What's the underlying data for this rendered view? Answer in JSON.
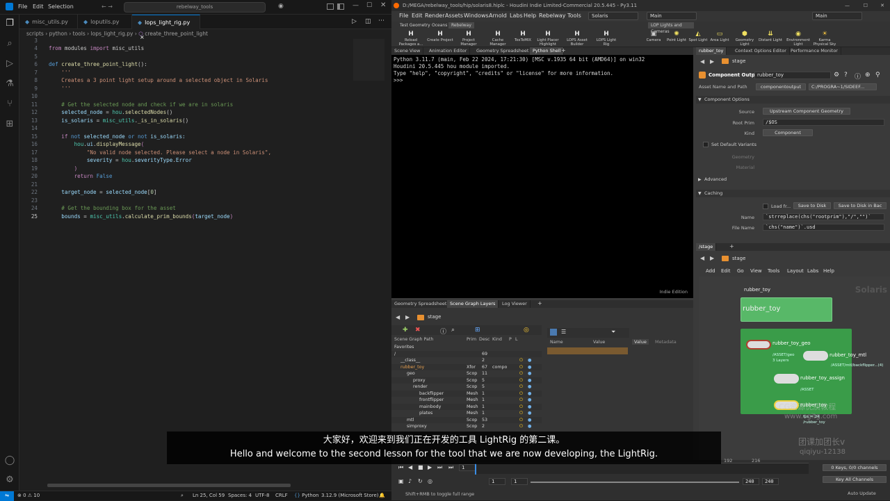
{
  "vscode": {
    "menu": [
      "File",
      "Edit",
      "Selection"
    ],
    "nav_arrows": "← →",
    "search": "rebelway_tools",
    "tabs": [
      {
        "label": "misc_utils.py"
      },
      {
        "label": "loputils.py"
      },
      {
        "label": "lops_light_rig.py"
      }
    ],
    "tab_close": "×",
    "breadcrumb": [
      "scripts",
      "python",
      "tools",
      "lops_light_rig.py",
      "create_three_point_light"
    ],
    "line_numbers": [
      "3",
      "4",
      "5",
      "6",
      "7",
      "8",
      "9",
      "10",
      "11",
      "12",
      "13",
      "14",
      "15",
      "16",
      "17",
      "18",
      "19",
      "20",
      "21",
      "22",
      "23",
      "24",
      "25"
    ],
    "code": {
      "l4a": "from",
      "l4b": " modules ",
      "l4c": "import",
      "l4d": " misc_utils",
      "l6a": "def ",
      "l6b": "create_three_point_light",
      "l6c": "():",
      "l7": "    '''",
      "l8": "    Creates a 3 point light setup around a selected object in Solaris",
      "l9": "    '''",
      "l11": "    # Get the selected node and check if we are in solaris",
      "l12a": "    selected_node",
      "l12b": " = ",
      "l12c": "hou",
      "l12d": ".",
      "l12e": "selectedNodes",
      "l12f": "()",
      "l13a": "    is_solaris",
      "l13b": " = ",
      "l13c": "misc_utils",
      "l13d": ".",
      "l13e": "_is_in_solaris",
      "l13f": "()",
      "l15a": "    if ",
      "l15b": "not ",
      "l15c": "selected_node ",
      "l15d": "or ",
      "l15e": "not ",
      "l15f": "is_solaris:",
      "l16a": "        hou",
      "l16b": ".",
      "l16c": "ui",
      "l16d": ".",
      "l16e": "displayMessage",
      "l16f": "(",
      "l17": "            \"No valid node selected. Please select a node in Solaris\",",
      "l18a": "            severity",
      "l18b": " = ",
      "l18c": "hou",
      "l18d": ".",
      "l18e": "severityType",
      "l18f": ".",
      "l18g": "Error",
      "l19": "        )",
      "l20a": "        return ",
      "l20b": "False",
      "l22a": "    target_node",
      "l22b": " = ",
      "l22c": "selected_node",
      "l22d": "[",
      "l22e": "0",
      "l22f": "]",
      "l24": "    # Get the bounding box for the asset",
      "l25a": "    bounds",
      "l25b": " = ",
      "l25c": "misc_utils",
      "l25d": ".",
      "l25e": "calculate_prim_bounds",
      "l25f": "(",
      "l25g": "target_node",
      "l25h": ")"
    },
    "status": {
      "errors": "⊗ 0 ⚠ 10",
      "ln_col": "Ln 25, Col 59",
      "spaces": "Spaces: 4",
      "encoding": "UTF-8",
      "eol": "CRLF",
      "language": "Python",
      "interpreter": "3.12.9 (Microsoft Store)"
    }
  },
  "houdini": {
    "title": "D:/MEGA/rebelway_tools/hip/solaris8.hiplc - Houdini Indie Limited-Commercial 20.5.445 - Py3.11",
    "menu": [
      "File",
      "Edit",
      "Render",
      "Assets",
      "Windows",
      "Arnold",
      "Labs",
      "Help",
      "Rebelway Tools"
    ],
    "desktop": "Solaris",
    "viewport_dd": "Main",
    "take_dd": "Main",
    "shelf_tabs": [
      "Test Geometry",
      "Oceans",
      "Rebelway"
    ],
    "shelf_tools": [
      "Reload Packages a...",
      "Create Project",
      "Project Manager",
      "Cache Manager",
      "TexToMIX",
      "Light Placer Highlight",
      "LOPS Asset Builder",
      "LOPS Light Rig"
    ],
    "lop_shelf_tab": "LOP Lights and Cameras",
    "lop_tools": [
      "Camera",
      "Point Light",
      "Spot Light",
      "Area Light",
      "Geometry Light",
      "Distant Light",
      "Environment Light",
      "Karma Physical Sky"
    ],
    "pane_tabs_main": [
      "Scene View",
      "Animation Editor",
      "Geometry Spreadsheet",
      "Python Shell"
    ],
    "python_shell": [
      "Python 3.11.7 (main, Feb 22 2024, 17:21:30) [MSC v.1935 64 bit (AMD64)] on win32",
      "Houdini 20.5.445 hou module imported.",
      "Type \"help\", \"copyright\", \"credits\" or \"license\" for more information.",
      ">>>"
    ],
    "indie_edition": "Indie Edition",
    "param_tabs": [
      "rubber_toy",
      "Context Options Editor",
      "Performance Monitor"
    ],
    "param_path": "stage",
    "node_type": "Component Output",
    "node_name": "rubber_toy",
    "asset_label": "Asset Name and Path",
    "asset_value": "componentoutput",
    "asset_path": "C:/PROGRA~1/SIDEEF...",
    "section_options": "Component Options",
    "source_label": "Source",
    "source_value": "Upstream Component Geometry",
    "rootprim_label": "Root Prim",
    "rootprim_value": "/$OS",
    "kind_label": "Kind",
    "kind_value": "Component",
    "default_variants": "Set Default Variants",
    "geometry_label": "Geometry",
    "material_label": "Material",
    "advanced": "Advanced",
    "caching": "Caching",
    "load_from": "Load fr...",
    "save_disk": "Save to Disk",
    "save_disk_bg": "Save to Disk in Bac",
    "name_label": "Name",
    "name_value": "`strreplace(chs(\"rootprim\"),\"/\",\"\")`",
    "file_label": "File Name",
    "file_value": "`chs(\"name\")`.usd",
    "net_tab": "/stage",
    "net_path": "stage",
    "net_menu": [
      "Add",
      "Edit",
      "Go",
      "View",
      "Tools",
      "Layout",
      "Labs",
      "Help"
    ],
    "net_watermark": "Solaris",
    "nodes": {
      "top_label": "rubber_toy",
      "subnet": "rubber_toy",
      "geo": "rubber_toy_geo",
      "geo_sub1": "/ASSET/geo",
      "geo_sub2": "3 Layers",
      "mtl": "rubber_toy_mtl",
      "mtl_sub": "/ASSET/mtl/backflipper...(4)",
      "assign": "rubber_toy_assign",
      "assign_sub": "/ASSET",
      "out": "rubber_toy",
      "out_sub1": "fps = 24",
      "out_sub2": "/rubber_toy"
    },
    "sg_tabs": [
      "Geometry Spreadsheet",
      "Scene Graph Layers",
      "Log Viewer"
    ],
    "sg_path": "stage",
    "sg_headers": [
      "Scene Graph Path",
      "Prim",
      "Desc",
      "Kind",
      "P",
      "L"
    ],
    "sg_rows": [
      {
        "name": "Favorites",
        "prim": "",
        "desc": "",
        "kind": ""
      },
      {
        "name": "/",
        "prim": "",
        "desc": "69",
        "kind": ""
      },
      {
        "name": "__class__",
        "prim": "",
        "desc": "2",
        "kind": ""
      },
      {
        "name": "rubber_toy",
        "prim": "Xfor",
        "desc": "67",
        "kind": "compo"
      },
      {
        "name": "geo",
        "prim": "Scop",
        "desc": "11",
        "kind": ""
      },
      {
        "name": "proxy",
        "prim": "Scop",
        "desc": "5",
        "kind": ""
      },
      {
        "name": "render",
        "prim": "Scop",
        "desc": "5",
        "kind": ""
      },
      {
        "name": "backflipper",
        "prim": "Mesh",
        "desc": "1",
        "kind": ""
      },
      {
        "name": "frontflipper",
        "prim": "Mesh",
        "desc": "1",
        "kind": ""
      },
      {
        "name": "mainbody",
        "prim": "Mesh",
        "desc": "1",
        "kind": ""
      },
      {
        "name": "plates",
        "prim": "Mesh",
        "desc": "1",
        "kind": ""
      },
      {
        "name": "mtl",
        "prim": "Scop",
        "desc": "53",
        "kind": ""
      },
      {
        "name": "simproxy",
        "prim": "Scop",
        "desc": "2",
        "kind": ""
      }
    ],
    "attr_headers": [
      "Name",
      "Value"
    ],
    "value_tabs": [
      "Value",
      "Metadata"
    ],
    "timeline": {
      "frame": "1",
      "start": "1",
      "start2": "1",
      "end": "240",
      "end2": "240",
      "ticks": [
        "192",
        "216"
      ],
      "keys": "0 Keys, 0/0 channels",
      "key_all": "Key All Channels",
      "hint": "Shift+RMB to toggle full range",
      "auto_update": "Auto Update"
    }
  },
  "subtitles": {
    "zh": "大家好，欢迎来到我们正在开发的工具 LightRig 的第二课。",
    "en": "Hello and welcome to the second lesson for the tool that we are now developing, the LightRig."
  },
  "watermarks": {
    "wm1": "CG资源优质教程",
    "wm2": "www.cgitg.com",
    "wm3": "团课加团长v",
    "wm4": "qiqiyu-12138"
  },
  "colors": {
    "vscode_bg": "#1f1f1f",
    "accent": "#0078d4",
    "node_green": "#3aa64a",
    "node_subnet": "#58b868"
  }
}
